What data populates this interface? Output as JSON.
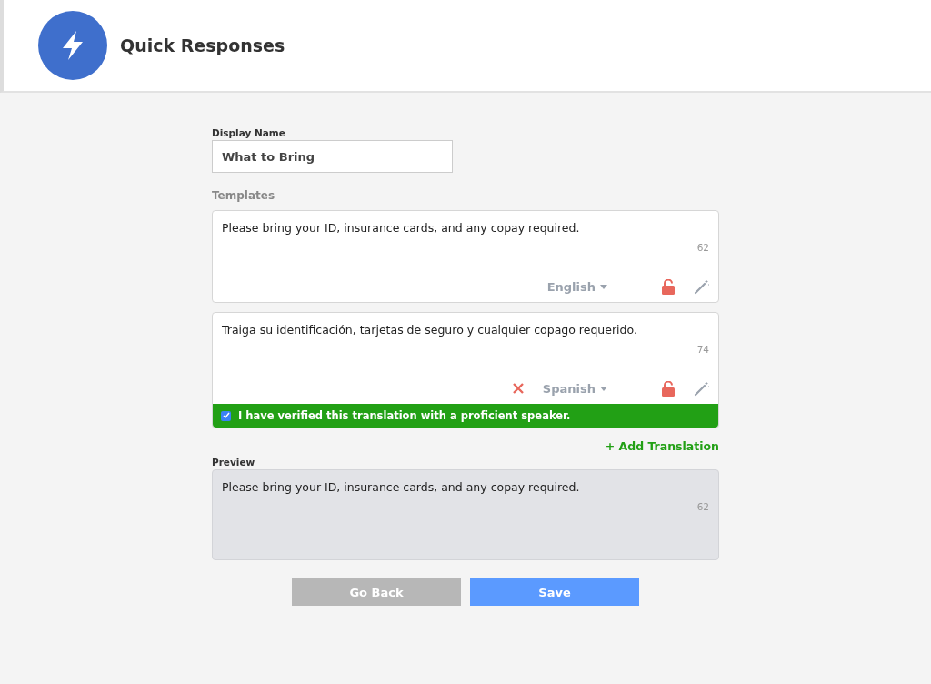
{
  "header": {
    "title": "Quick Responses"
  },
  "display_name": {
    "label": "Display Name",
    "value": "What to Bring"
  },
  "templates": {
    "label": "Templates",
    "items": [
      {
        "text": "Please bring your ID, insurance cards, and any copay required.",
        "count": "62",
        "language": "English",
        "removable": false
      },
      {
        "text": "Traiga su identificación, tarjetas de seguro y cualquier copago requerido.",
        "count": "74",
        "language": "Spanish",
        "removable": true,
        "verification": {
          "label": "I have verified this translation with a proficient speaker.",
          "checked": true
        }
      }
    ]
  },
  "add_translation": "+ Add Translation",
  "preview": {
    "label": "Preview",
    "text": "Please bring your ID, insurance cards, and any copay required.",
    "count": "62"
  },
  "buttons": [
    {
      "label": "Go Back",
      "kind": "secondary"
    },
    {
      "label": "Save",
      "kind": "primary"
    }
  ]
}
